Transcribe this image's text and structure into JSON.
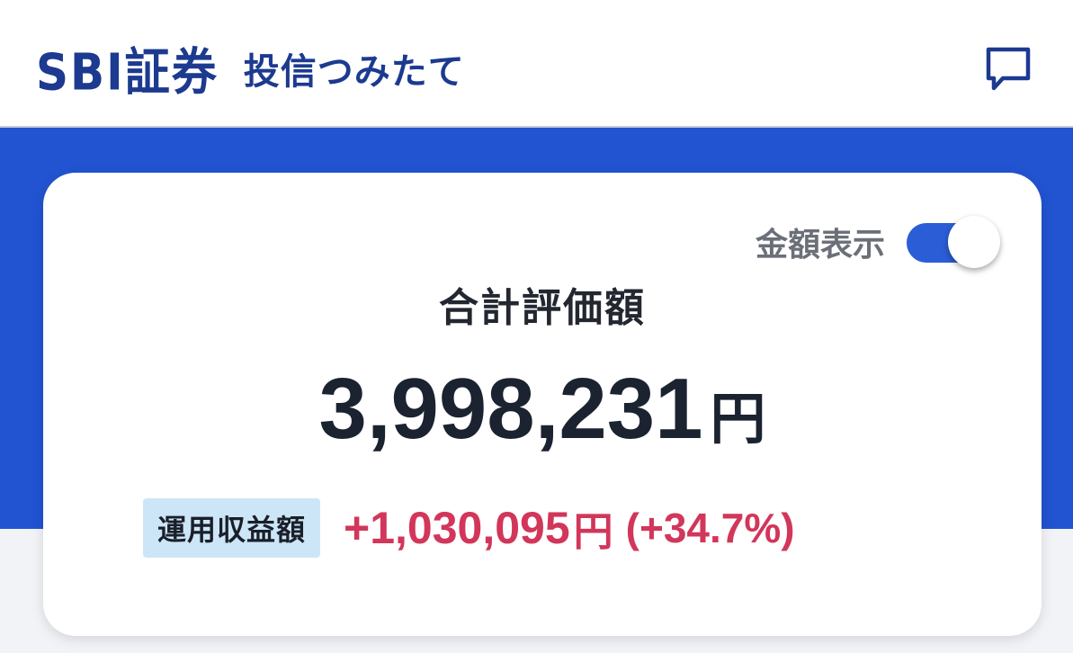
{
  "header": {
    "brand": "SBI証券",
    "subtitle": "投信つみたて",
    "chat_icon": "chat-bubble-icon"
  },
  "card": {
    "toggle_label": "金額表示",
    "toggle_on": true,
    "total_label": "合計評価額",
    "total_value": "3,998,231",
    "total_unit": "円",
    "profit_label": "運用収益額",
    "profit_value": "+1,030,095",
    "profit_unit": "円",
    "profit_percent": "(+34.7%)"
  },
  "colors": {
    "brand": "#1c3a8f",
    "accent_blue": "#2253d1",
    "toggle_on": "#2b5dd6",
    "profit": "#d2365a",
    "badge_bg": "#cde6f7"
  }
}
